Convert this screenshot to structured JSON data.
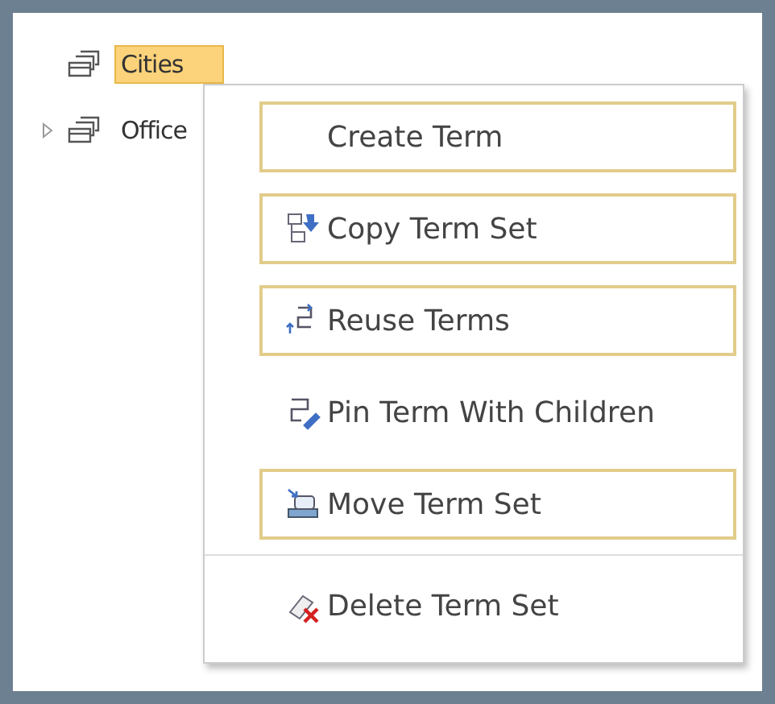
{
  "tree": [
    {
      "label": "Cities",
      "selected": true,
      "expandable": false
    },
    {
      "label": "Office",
      "selected": false,
      "expandable": true
    }
  ],
  "context_menu": [
    {
      "kind": "item",
      "label": "Create Term",
      "highlighted": true
    },
    {
      "kind": "item",
      "label": "Copy Term Set",
      "highlighted": true
    },
    {
      "kind": "item",
      "label": "Reuse Terms",
      "highlighted": true
    },
    {
      "kind": "item",
      "label": "Pin Term With Children",
      "highlighted": false
    },
    {
      "kind": "item",
      "label": "Move Term Set",
      "highlighted": true
    },
    {
      "kind": "divider"
    },
    {
      "kind": "item",
      "label": "Delete Term Set",
      "highlighted": false
    }
  ]
}
